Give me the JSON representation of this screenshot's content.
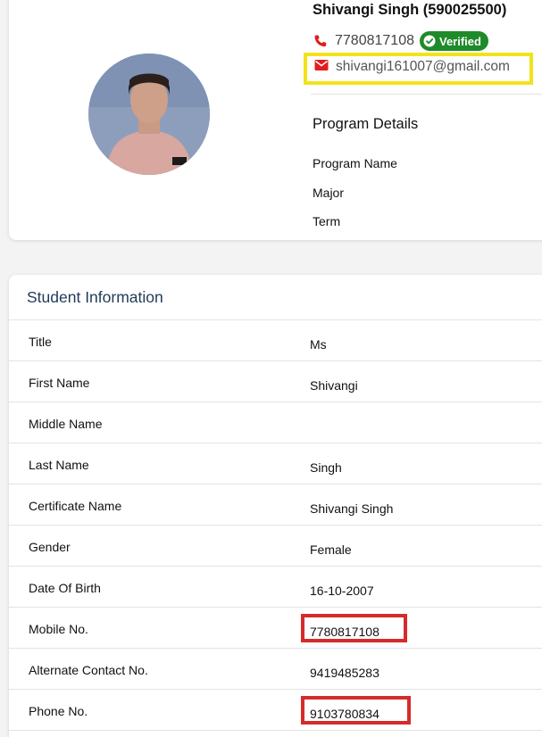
{
  "profile": {
    "name": "Shivangi Singh (590025500)",
    "phone": "7780817108",
    "verified_label": "Verified",
    "email": "shivangi161007@gmail.com",
    "program_heading": "Program Details",
    "program_labels": [
      "Program Name",
      "Major",
      "Term"
    ]
  },
  "student_info": {
    "title": "Student Information",
    "rows": [
      {
        "label": "Title",
        "value": "Ms"
      },
      {
        "label": "First Name",
        "value": "Shivangi"
      },
      {
        "label": "Middle Name",
        "value": ""
      },
      {
        "label": "Last Name",
        "value": "Singh"
      },
      {
        "label": "Certificate Name",
        "value": "Shivangi Singh"
      },
      {
        "label": "Gender",
        "value": "Female"
      },
      {
        "label": "Date Of Birth",
        "value": "16-10-2007"
      },
      {
        "label": "Mobile No.",
        "value": "7780817108"
      },
      {
        "label": "Alternate Contact No.",
        "value": "9419485283"
      },
      {
        "label": "Phone No.",
        "value": "9103780834"
      }
    ]
  },
  "colors": {
    "accent_red": "#e11d1d",
    "verified_green": "#1f8a2a",
    "email_highlight": "#f2e21a",
    "row_highlight": "#d52b2b",
    "heading_blue": "#1f3b57"
  },
  "icons": [
    "phone-icon",
    "check-circle-icon",
    "mail-icon"
  ]
}
